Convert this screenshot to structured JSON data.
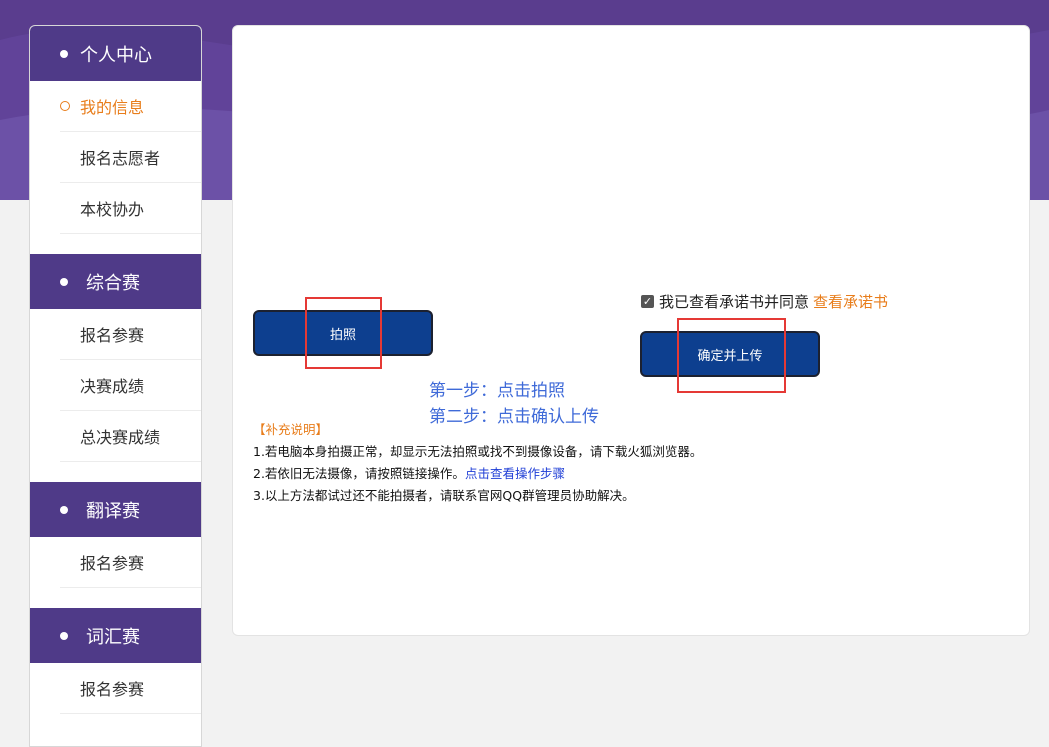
{
  "sidebar": {
    "sections": [
      {
        "title": "个人中心",
        "items": [
          "我的信息",
          "报名志愿者",
          "本校协办"
        ]
      },
      {
        "title": "综合赛",
        "items": [
          "报名参赛",
          "决赛成绩",
          "总决赛成绩"
        ]
      },
      {
        "title": "翻译赛",
        "items": [
          "报名参赛"
        ]
      },
      {
        "title": "词汇赛",
        "items": [
          "报名参赛"
        ]
      }
    ]
  },
  "main": {
    "photo_button": "拍照",
    "agree_text": "我已查看承诺书并同意",
    "agree_link": "查看承诺书",
    "agree_checked": true,
    "confirm_button": "确定并上传",
    "step1": "第一步：点击拍照",
    "step2": "第二步：点击确认上传",
    "notes_tag": "【补充说明】",
    "note1": "1.若电脑本身拍摄正常，却显示无法拍照或找不到摄像设备，请下载火狐浏览器。",
    "note2_prefix": "2.若依旧无法摄像，请按照链接操作。",
    "note2_link": "点击查看操作步骤",
    "note3": "3.以上方法都试过还不能拍摄者，请联系官网QQ群管理员协助解决。"
  },
  "colors": {
    "header_purple": "#5a3d8e",
    "sidebar_head": "#4f3a88",
    "accent_orange": "#e87d1b",
    "button_blue": "#0d3f8f",
    "step_blue": "#3f6ad8",
    "highlight_red": "#e53935"
  }
}
